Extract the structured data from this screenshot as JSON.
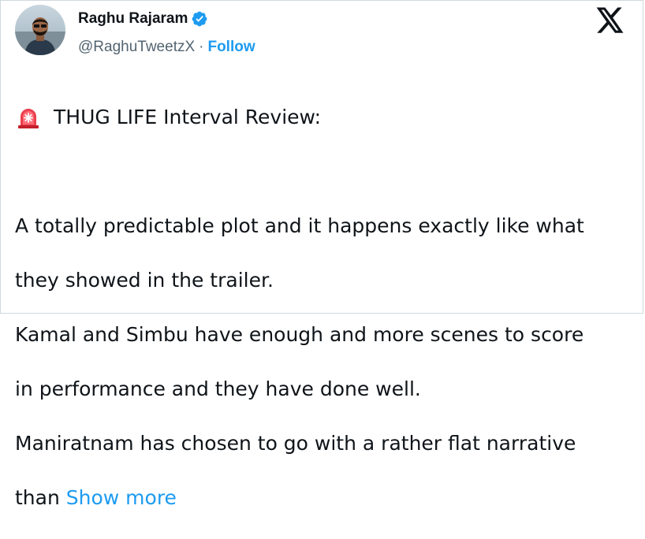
{
  "author": {
    "display_name": "Raghu Rajaram",
    "handle": "@RaghuTweetzX",
    "separator": "·",
    "follow_label": "Follow",
    "avatar_icon": "avatar-photo",
    "verified_icon": "verified-badge-icon"
  },
  "header": {
    "logo_icon": "x-logo-icon"
  },
  "tweet": {
    "title_icon": "police-siren-icon",
    "title": "THUG LIFE Interval Review:",
    "lines": [
      "A totally predictable plot and it happens exactly like what",
      "they showed in the trailer.",
      "Kamal and Simbu have enough and more scenes to score",
      "in performance and they have done well.",
      "Maniratnam has chosen to go with a rather flat narrative"
    ],
    "last_line_text": "than",
    "show_more_label": "Show more"
  },
  "colors": {
    "text": "#0f1419",
    "secondary": "#536471",
    "accent": "#1d9bf0",
    "border": "#cfd9de"
  }
}
